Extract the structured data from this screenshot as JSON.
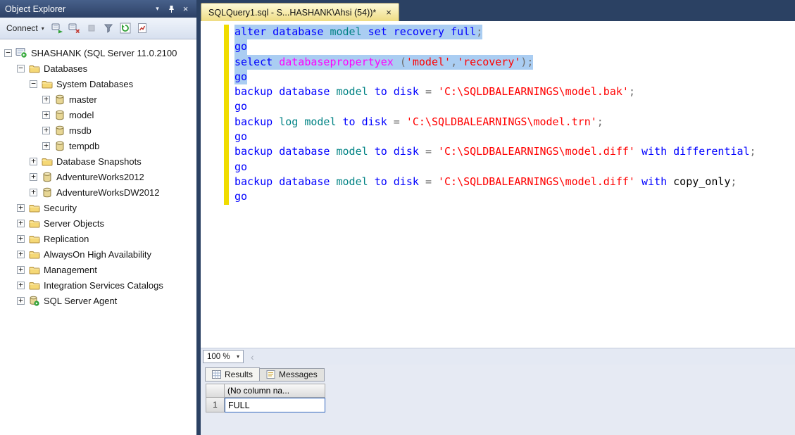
{
  "colors": {
    "keyword": "#0000ff",
    "object_name": "#008284",
    "system_function": "#ff00ff",
    "string": "#ff0000",
    "operator": "#6f6f6f",
    "plain": "#000000",
    "selection_bg": "#aacdf2",
    "change_bar": "#f0dc00",
    "selected_cell_border": "#3166bd"
  },
  "object_explorer": {
    "title": "Object Explorer",
    "connect_label": "Connect",
    "toolbar_icons": [
      "connect",
      "disconnect",
      "stop",
      "filter",
      "refresh",
      "activity"
    ],
    "tree": [
      {
        "label": "SHASHANK (SQL Server 11.0.2100",
        "level": 0,
        "expander": "minus",
        "icon": "server"
      },
      {
        "label": "Databases",
        "level": 1,
        "expander": "minus",
        "icon": "folder"
      },
      {
        "label": "System Databases",
        "level": 2,
        "expander": "minus",
        "icon": "folder"
      },
      {
        "label": "master",
        "level": 3,
        "expander": "plus",
        "icon": "database"
      },
      {
        "label": "model",
        "level": 3,
        "expander": "plus",
        "icon": "database"
      },
      {
        "label": "msdb",
        "level": 3,
        "expander": "plus",
        "icon": "database"
      },
      {
        "label": "tempdb",
        "level": 3,
        "expander": "plus",
        "icon": "database"
      },
      {
        "label": "Database Snapshots",
        "level": 2,
        "expander": "plus",
        "icon": "folder"
      },
      {
        "label": "AdventureWorks2012",
        "level": 2,
        "expander": "plus",
        "icon": "database"
      },
      {
        "label": "AdventureWorksDW2012",
        "level": 2,
        "expander": "plus",
        "icon": "database"
      },
      {
        "label": "Security",
        "level": 1,
        "expander": "plus",
        "icon": "folder"
      },
      {
        "label": "Server Objects",
        "level": 1,
        "expander": "plus",
        "icon": "folder"
      },
      {
        "label": "Replication",
        "level": 1,
        "expander": "plus",
        "icon": "folder"
      },
      {
        "label": "AlwaysOn High Availability",
        "level": 1,
        "expander": "plus",
        "icon": "folder"
      },
      {
        "label": "Management",
        "level": 1,
        "expander": "plus",
        "icon": "folder"
      },
      {
        "label": "Integration Services Catalogs",
        "level": 1,
        "expander": "plus",
        "icon": "folder"
      },
      {
        "label": "SQL Server Agent",
        "level": 1,
        "expander": "plus",
        "icon": "agent"
      }
    ]
  },
  "document": {
    "tab_title": "SQLQuery1.sql - S...HASHANK\\Ahsi (54))*",
    "close_glyph": "×"
  },
  "editor": {
    "lines": [
      {
        "selected": true,
        "tokens": [
          [
            "alter database ",
            "keyword"
          ],
          [
            "model ",
            "object_name"
          ],
          [
            "set recovery full",
            "keyword"
          ],
          [
            ";",
            "operator"
          ]
        ]
      },
      {
        "selected": true,
        "tokens": [
          [
            "go",
            "keyword"
          ]
        ]
      },
      {
        "selected": true,
        "tokens": [
          [
            "select ",
            "keyword"
          ],
          [
            "databasepropertyex ",
            "system_function"
          ],
          [
            "(",
            "operator"
          ],
          [
            "'model'",
            "string"
          ],
          [
            ",",
            "operator"
          ],
          [
            "'recovery'",
            "string"
          ],
          [
            ");",
            "operator"
          ]
        ]
      },
      {
        "selected": true,
        "tokens": [
          [
            "go",
            "keyword"
          ]
        ]
      },
      {
        "selected": false,
        "tokens": [
          [
            "backup database ",
            "keyword"
          ],
          [
            "model ",
            "object_name"
          ],
          [
            "to disk ",
            "keyword"
          ],
          [
            "= ",
            "operator"
          ],
          [
            "'C:\\SQLDBALEARNINGS\\model.bak'",
            "string"
          ],
          [
            ";",
            "operator"
          ]
        ]
      },
      {
        "selected": false,
        "tokens": [
          [
            "go",
            "keyword"
          ]
        ]
      },
      {
        "selected": false,
        "tokens": [
          [
            "backup ",
            "keyword"
          ],
          [
            "log ",
            "object_name"
          ],
          [
            "model ",
            "object_name"
          ],
          [
            "to disk ",
            "keyword"
          ],
          [
            "= ",
            "operator"
          ],
          [
            "'C:\\SQLDBALEARNINGS\\model.trn'",
            "string"
          ],
          [
            ";",
            "operator"
          ]
        ]
      },
      {
        "selected": false,
        "tokens": [
          [
            "go",
            "keyword"
          ]
        ]
      },
      {
        "selected": false,
        "tokens": [
          [
            "backup database ",
            "keyword"
          ],
          [
            "model ",
            "object_name"
          ],
          [
            "to disk ",
            "keyword"
          ],
          [
            "= ",
            "operator"
          ],
          [
            "'C:\\SQLDBALEARNINGS\\model.diff' ",
            "string"
          ],
          [
            "with differential",
            "keyword"
          ],
          [
            ";",
            "operator"
          ]
        ]
      },
      {
        "selected": false,
        "tokens": [
          [
            "go",
            "keyword"
          ]
        ]
      },
      {
        "selected": false,
        "tokens": [
          [
            "backup database ",
            "keyword"
          ],
          [
            "model ",
            "object_name"
          ],
          [
            "to disk ",
            "keyword"
          ],
          [
            "= ",
            "operator"
          ],
          [
            "'C:\\SQLDBALEARNINGS\\model.diff' ",
            "string"
          ],
          [
            "with ",
            "keyword"
          ],
          [
            "copy_only",
            "plain"
          ],
          [
            ";",
            "operator"
          ]
        ]
      },
      {
        "selected": false,
        "tokens": [
          [
            "go",
            "keyword"
          ]
        ]
      }
    ]
  },
  "statusbar": {
    "zoom": "100 %",
    "scroll_left_glyph": "‹"
  },
  "results_pane": {
    "tabs": [
      {
        "label": "Results",
        "icon": "results-grid",
        "active": true
      },
      {
        "label": "Messages",
        "icon": "messages",
        "active": false
      }
    ],
    "grid": {
      "columns": [
        "(No column na..."
      ],
      "rows": [
        {
          "row_number": "1",
          "cells": [
            "FULL"
          ]
        }
      ]
    }
  }
}
